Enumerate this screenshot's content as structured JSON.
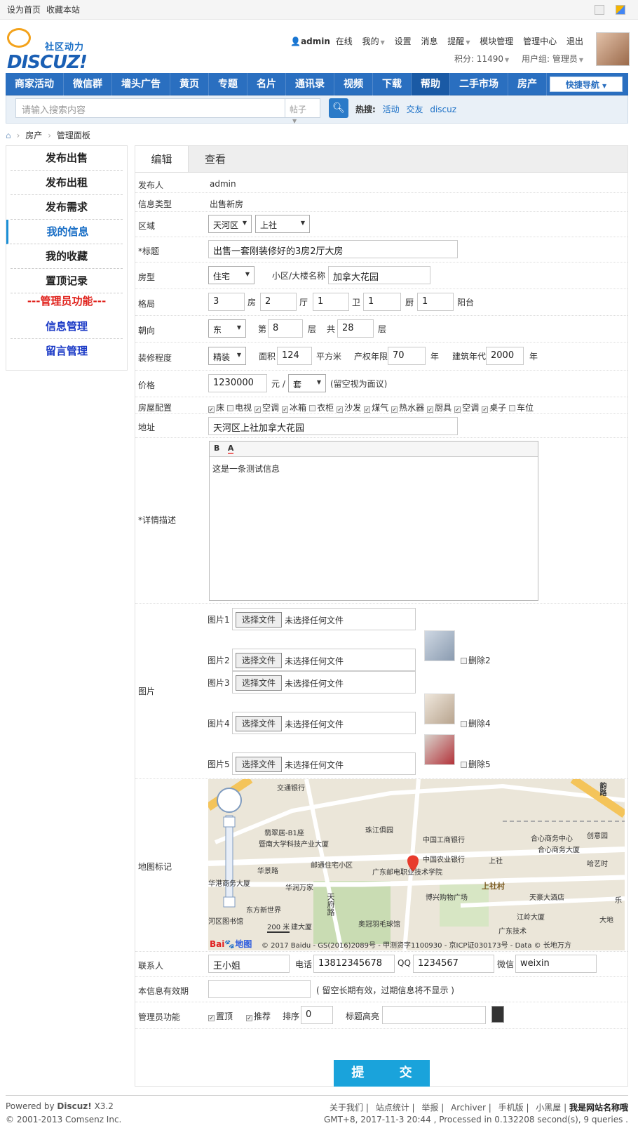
{
  "topbar": {
    "set_home": "设为首页",
    "bookmark": "收藏本站"
  },
  "logo": {
    "slogan": "社区动力",
    "word": "DISCUZ!"
  },
  "user": {
    "name": "admin",
    "online": "在线",
    "my": "我的",
    "settings": "设置",
    "messages": "消息",
    "reminders": "提醒",
    "module_mgmt": "模块管理",
    "admin_center": "管理中心",
    "logout": "退出",
    "points": "积分: 11490",
    "group": "用户组: 管理员"
  },
  "nav": {
    "items": [
      "商家活动",
      "微信群",
      "墙头广告",
      "黄页",
      "专题",
      "名片",
      "通讯录",
      "视频",
      "下载",
      "帮助",
      "二手市场",
      "房产"
    ],
    "quick": "快捷导航"
  },
  "search": {
    "placeholder": "请输入搜索内容",
    "scope": "帖子",
    "hot_label": "热搜:",
    "hot": [
      "活动",
      "交友",
      "discuz"
    ]
  },
  "breadcrumb": {
    "home_icon": "home-icon",
    "items": [
      "房产",
      "管理面板"
    ]
  },
  "sidebar": {
    "items": [
      "发布出售",
      "发布出租",
      "发布需求",
      "我的信息",
      "我的收藏",
      "置顶记录"
    ],
    "admin_title": "---管理员功能---",
    "admin_items": [
      "信息管理",
      "留言管理"
    ]
  },
  "tabs": [
    "编辑",
    "查看"
  ],
  "form": {
    "poster_label": "发布人",
    "poster": "admin",
    "type_label": "信息类型",
    "type": "出售新房",
    "area_label": "区域",
    "district": "天河区",
    "street": "上社",
    "title_label": "*标题",
    "title": "出售一套刚装修好的3房2厅大房",
    "house_label": "房型",
    "house_type": "住宅",
    "community_label": "小区/大楼名称",
    "community": "加拿大花园",
    "layout_label": "格局",
    "rooms": "3",
    "rooms_u": "房",
    "halls": "2",
    "halls_u": "厅",
    "baths": "1",
    "baths_u": "卫",
    "kitchens": "1",
    "kitchens_u": "厨",
    "balconies": "1",
    "balconies_u": "阳台",
    "facing_label": "朝向",
    "facing": "东",
    "floor_pre": "第",
    "floor": "8",
    "floor_u": "层",
    "total_pre": "共",
    "total": "28",
    "total_u": "层",
    "deco_label": "装修程度",
    "deco": "精装",
    "area_sz_label": "面积",
    "area_sz": "124",
    "area_sz_u": "平方米",
    "years_label": "产权年限",
    "years": "70",
    "years_u": "年",
    "built_label": "建筑年代",
    "built": "2000",
    "built_u": "年",
    "price_label": "价格",
    "price": "1230000",
    "price_u": "元 /",
    "price_unit": "套",
    "price_note": "(留空视为面议)",
    "equip_label": "房屋配置",
    "equip": [
      {
        "n": "床",
        "c": true
      },
      {
        "n": "电视",
        "c": false
      },
      {
        "n": "空调",
        "c": true
      },
      {
        "n": "冰箱",
        "c": true
      },
      {
        "n": "衣柜",
        "c": false
      },
      {
        "n": "沙发",
        "c": true
      },
      {
        "n": "煤气",
        "c": true
      },
      {
        "n": "热水器",
        "c": true
      },
      {
        "n": "厨具",
        "c": true
      },
      {
        "n": "空调",
        "c": true
      },
      {
        "n": "桌子",
        "c": true
      },
      {
        "n": "车位",
        "c": false
      }
    ],
    "addr_label": "地址",
    "addr": "天河区上社加拿大花园",
    "desc_label": "*详情描述",
    "desc": "这是一条测试信息",
    "bold_btn": "B",
    "color_btn": "A",
    "pic_label": "图片",
    "pics": [
      {
        "l": "图片1",
        "b": "选择文件",
        "t": "未选择任何文件",
        "del": ""
      },
      {
        "l": "图片2",
        "b": "选择文件",
        "t": "未选择任何文件",
        "del": "删除2"
      },
      {
        "l": "图片3",
        "b": "选择文件",
        "t": "未选择任何文件",
        "del": ""
      },
      {
        "l": "图片4",
        "b": "选择文件",
        "t": "未选择任何文件",
        "del": "删除4"
      },
      {
        "l": "图片5",
        "b": "选择文件",
        "t": "未选择任何文件",
        "del": "删除5"
      }
    ],
    "map_label": "地图标记",
    "map": {
      "labels": [
        "交通银行",
        "翡翠居-B1座",
        "暨南大学科技产业大厦",
        "珠江俱园",
        "中国工商银行",
        "中国农业银行",
        "邮通住宅小区",
        "华景路",
        "广东邮电职业技术学院",
        "合心商务中心",
        "合心商务大厦",
        "上社",
        "创意园",
        "哈艺时",
        "华港商务大厦",
        "华润万家",
        "博兴购物广场",
        "上社村",
        "天豪大酒店",
        "东方新世界",
        "天府路",
        "江岭大厦",
        "河区图书馆",
        "奥冠羽毛球馆",
        "广东技术",
        "大地",
        "韵路",
        "建大厦",
        "乐",
        "200 米"
      ],
      "copy": "© 2017 Baidu - GS(2016)2089号 - 甲测资字1100930 - 京ICP证030173号 - Data © 长地万方",
      "brand": "Bai",
      "brand2": "地图"
    },
    "contact_label": "联系人",
    "contact": "王小姐",
    "phone_label": "电话",
    "phone": "13812345678",
    "qq_label": "QQ",
    "qq": "1234567",
    "wx_label": "微信",
    "wx": "weixin",
    "valid_label": "本信息有效期",
    "valid_note": "( 留空长期有效，过期信息将不显示 )",
    "admin_label": "管理员功能",
    "top": "置顶",
    "recommend": "推荐",
    "sort_label": "排序",
    "sort": "0",
    "hl_label": "标题高亮",
    "submit": "提 交"
  },
  "footer": {
    "powered": "Powered by",
    "brand": "Discuz!",
    "ver": "X3.2",
    "copy": "© 2001-2013 Comsenz Inc.",
    "links": [
      "关于我们",
      "站点统计",
      "举报",
      "Archiver",
      "手机版",
      "小黑屋"
    ],
    "sitename": "我是网站名称哦",
    "stats": "GMT+8, 2017-11-3 20:44 , Processed in 0.132208 second(s), 9 queries ."
  }
}
